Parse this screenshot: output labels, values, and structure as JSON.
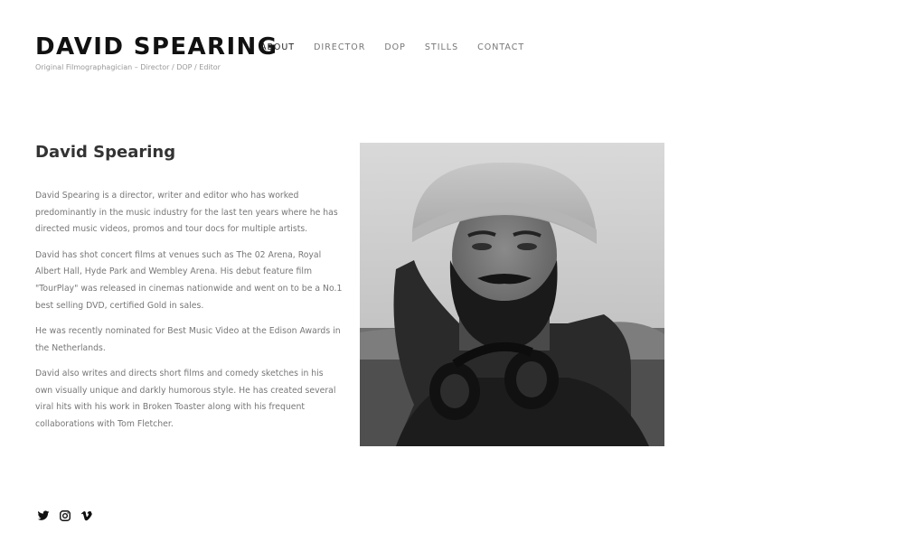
{
  "header": {
    "site_title": "DAVID SPEARING",
    "tagline": "Original Filmographagician – Director / DOP / Editor"
  },
  "nav": {
    "items": [
      {
        "label": "ABOUT",
        "active": true
      },
      {
        "label": "DIRECTOR"
      },
      {
        "label": "DOP"
      },
      {
        "label": "STILLS"
      },
      {
        "label": "CONTACT"
      }
    ]
  },
  "about": {
    "heading": "David Spearing",
    "paragraphs": [
      "David Spearing is a director, writer and editor who has worked predominantly in the music industry for the last ten years where he has directed music videos, promos and tour docs for multiple artists.",
      "David has shot concert films at venues such as The 02 Arena, Royal Albert Hall, Hyde Park and Wembley Arena. His debut feature film \"TourPlay\" was released in cinemas nationwide and went on to be a No.1 best selling DVD, certified Gold in sales.",
      "He was recently nominated for Best Music Video at the Edison Awards in the Netherlands.",
      "David also writes and directs short films and comedy sketches in his own visually unique and darkly humorous style. He has created several viral hits with his work in Broken Toaster along with his frequent collaborations with Tom Fletcher."
    ]
  },
  "photo": {
    "style": "black-and-white portrait of a bearded man in a beanie with headphones around his neck"
  },
  "social": {
    "icons": [
      "twitter-icon",
      "instagram-icon",
      "vimeo-icon"
    ]
  }
}
